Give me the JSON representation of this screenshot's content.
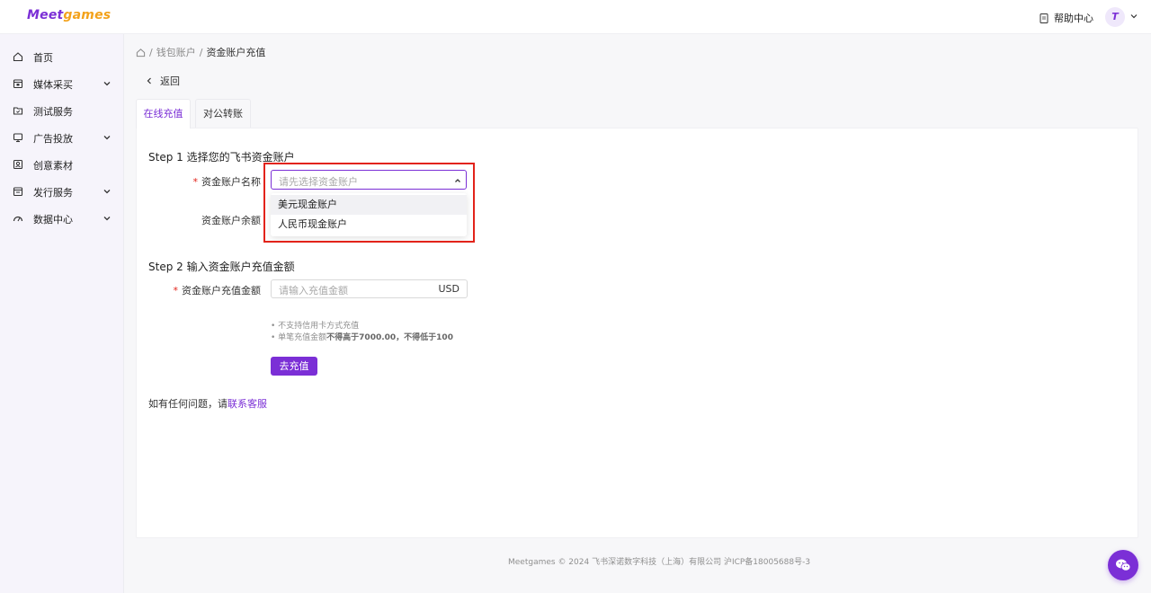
{
  "brand": {
    "logo_part1": "Meet",
    "logo_part2": "games",
    "accent_color": "#7b2fd6"
  },
  "header": {
    "help_label": "帮助中心",
    "avatar_letter": "T"
  },
  "sidebar": {
    "items": [
      {
        "label": "首页",
        "icon": "home-icon",
        "has_submenu": false
      },
      {
        "label": "媒体采买",
        "icon": "media-icon",
        "has_submenu": true
      },
      {
        "label": "测试服务",
        "icon": "folder-icon",
        "has_submenu": false
      },
      {
        "label": "广告投放",
        "icon": "ad-icon",
        "has_submenu": true
      },
      {
        "label": "创意素材",
        "icon": "creative-icon",
        "has_submenu": false
      },
      {
        "label": "发行服务",
        "icon": "publish-icon",
        "has_submenu": true
      },
      {
        "label": "数据中心",
        "icon": "data-icon",
        "has_submenu": true
      }
    ]
  },
  "breadcrumb": {
    "sep": "/",
    "parent": "钱包账户",
    "current": "资金账户充值"
  },
  "back_label": "返回",
  "tabs": [
    {
      "label": "在线充值",
      "active": true
    },
    {
      "label": "对公转账",
      "active": false
    }
  ],
  "step1": {
    "title": "Step 1 选择您的飞书资金账户",
    "account_label": "资金账户名称",
    "account_placeholder": "请先选择资金账户",
    "options": [
      "美元现金账户",
      "人民币现金账户"
    ],
    "balance_label": "资金账户余额"
  },
  "step2": {
    "title": "Step 2 输入资金账户充值金额",
    "amount_label": "资金账户充值金额",
    "amount_placeholder": "请输入充值金额",
    "currency": "USD",
    "note1": "• 不支持信用卡方式充值",
    "note2_prefix": "• 单笔充值金额",
    "note2_bold": "不得高于7000.00，不得低于100",
    "submit_label": "去充值"
  },
  "contact": {
    "text": "如有任何问题，请",
    "link": "联系客服"
  },
  "footer": "Meetgames © 2024 飞书深诺数字科技（上海）有限公司 沪ICP备18005688号-3"
}
